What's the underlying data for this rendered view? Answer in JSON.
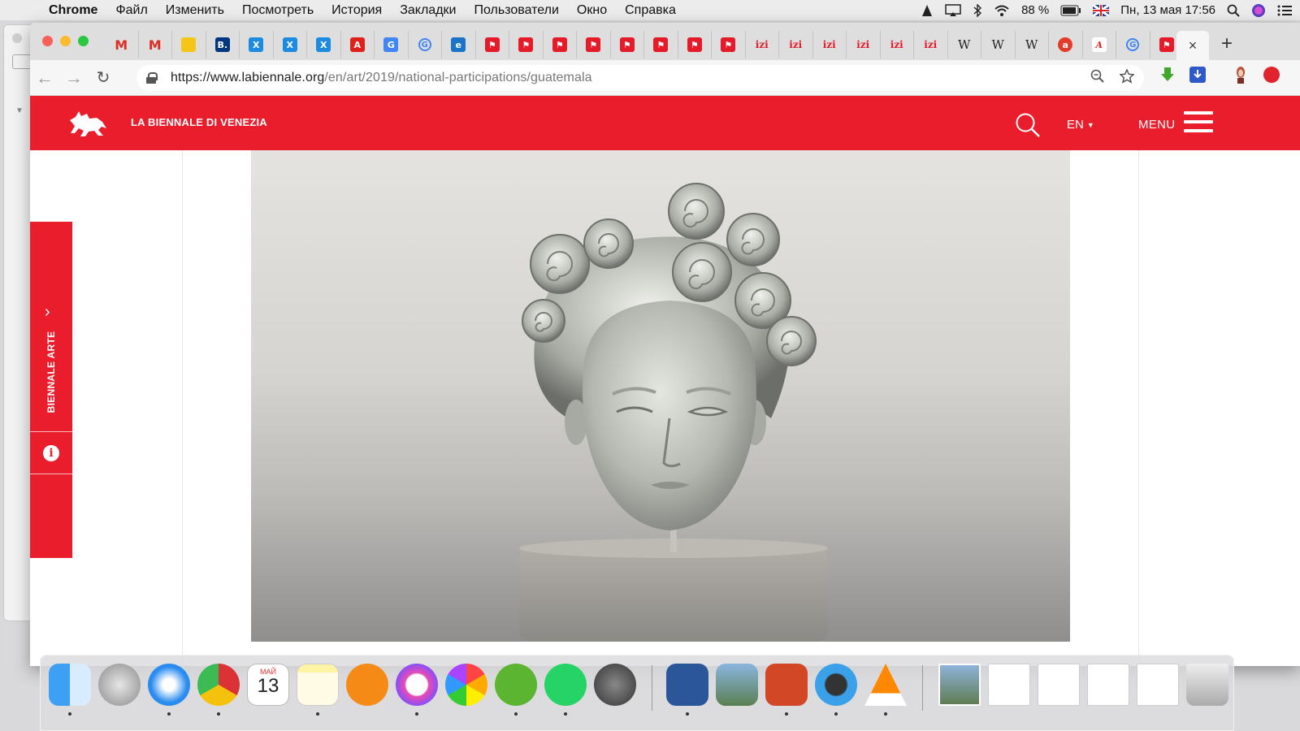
{
  "menubar": {
    "app": "Chrome",
    "items": [
      "Файл",
      "Изменить",
      "Посмотреть",
      "История",
      "Закладки",
      "Пользователи",
      "Окно",
      "Справка"
    ],
    "battery": "88 %",
    "datetime": "Пн, 13 мая  17:56"
  },
  "browser": {
    "url_host": "https://www.labiennale.org",
    "url_path": "/en/art/2019/national-participations/guatemala",
    "close_tab": "×",
    "new_tab": "+",
    "pinned_tabs": [
      {
        "icon": "gmail-icon",
        "glyph": "M"
      },
      {
        "icon": "gmail-icon",
        "glyph": "M"
      },
      {
        "icon": "mail-icon",
        "glyph": ""
      },
      {
        "icon": "booking-icon",
        "glyph": "B."
      },
      {
        "icon": "tool-icon",
        "glyph": "X"
      },
      {
        "icon": "tool-icon",
        "glyph": "X"
      },
      {
        "icon": "tool-icon",
        "glyph": "X"
      },
      {
        "icon": "acrobat-icon",
        "glyph": "A"
      },
      {
        "icon": "translate-icon",
        "glyph": "G"
      },
      {
        "icon": "google-icon",
        "glyph": "G"
      },
      {
        "icon": "edge-icon",
        "glyph": "e"
      },
      {
        "icon": "biennale-icon",
        "glyph": "⚑"
      },
      {
        "icon": "biennale-icon",
        "glyph": "⚑"
      },
      {
        "icon": "biennale-icon",
        "glyph": "⚑"
      },
      {
        "icon": "biennale-icon",
        "glyph": "⚑"
      },
      {
        "icon": "biennale-icon",
        "glyph": "⚑"
      },
      {
        "icon": "biennale-icon",
        "glyph": "⚑"
      },
      {
        "icon": "biennale-icon",
        "glyph": "⚑"
      },
      {
        "icon": "biennale-icon",
        "glyph": "⚑"
      },
      {
        "icon": "izi-icon",
        "glyph": "izi"
      },
      {
        "icon": "izi-icon",
        "glyph": "izi"
      },
      {
        "icon": "izi-icon",
        "glyph": "izi"
      },
      {
        "icon": "izi-icon",
        "glyph": "izi"
      },
      {
        "icon": "izi-icon",
        "glyph": "izi"
      },
      {
        "icon": "izi-icon",
        "glyph": "izi"
      },
      {
        "icon": "wikipedia-icon",
        "glyph": "W"
      },
      {
        "icon": "wikipedia-icon",
        "glyph": "W"
      },
      {
        "icon": "wikipedia-icon",
        "glyph": "W"
      },
      {
        "icon": "a-icon",
        "glyph": "a"
      },
      {
        "icon": "script-a-icon",
        "glyph": "A"
      },
      {
        "icon": "google-icon",
        "glyph": "G"
      },
      {
        "icon": "biennale-icon",
        "glyph": "⚑"
      }
    ]
  },
  "site": {
    "brand": "LA BIENNALE DI VENEZIA",
    "lang": "EN",
    "menu": "MENU",
    "sidebar_label": "BIENNALE ARTE",
    "info": "i"
  },
  "colors": {
    "brand_red": "#ea1d2c"
  },
  "dock": {
    "calendar_month": "МАЙ",
    "calendar_day": "13"
  }
}
